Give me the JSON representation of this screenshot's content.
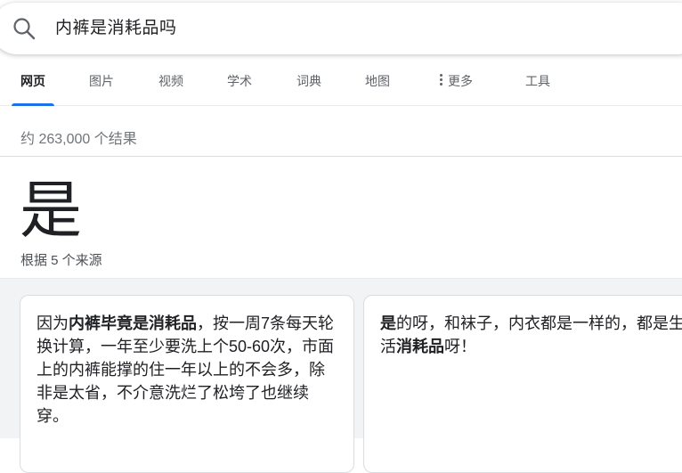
{
  "search": {
    "query": "内裤是消耗品吗"
  },
  "tabs": [
    {
      "label": "网页",
      "active": true
    },
    {
      "label": "图片"
    },
    {
      "label": "视频"
    },
    {
      "label": "学术"
    },
    {
      "label": "词典"
    },
    {
      "label": "地图"
    },
    {
      "label": "更多",
      "icon": "more-vert-icon"
    },
    {
      "label": "工具"
    }
  ],
  "result_stats": "约 263,000 个结果",
  "answer": {
    "text": "是",
    "source_count": "根据 5 个来源"
  },
  "cards": [
    {
      "segments": [
        {
          "text": "因为",
          "bold": false
        },
        {
          "text": "内裤毕竟是消耗品",
          "bold": true
        },
        {
          "text": "，按一周7条每天轮换计算，一年至少要洗上个50-60次，市面上的内裤能撑的住一年以上的不会多，除非是太省，不介意洗烂了松垮了也继续穿。",
          "bold": false
        }
      ]
    },
    {
      "segments": [
        {
          "text": "是",
          "bold": true
        },
        {
          "text": "的呀，和袜子，内衣都是一样的，都是生活",
          "bold": false
        },
        {
          "text": "消耗品",
          "bold": true
        },
        {
          "text": "呀！",
          "bold": false
        }
      ]
    }
  ],
  "colors": {
    "accent": "#1a73e8",
    "text_primary": "#202124",
    "text_secondary": "#5f6368",
    "stats_gray": "#70757a",
    "cards_background": "#f1f3f4"
  }
}
